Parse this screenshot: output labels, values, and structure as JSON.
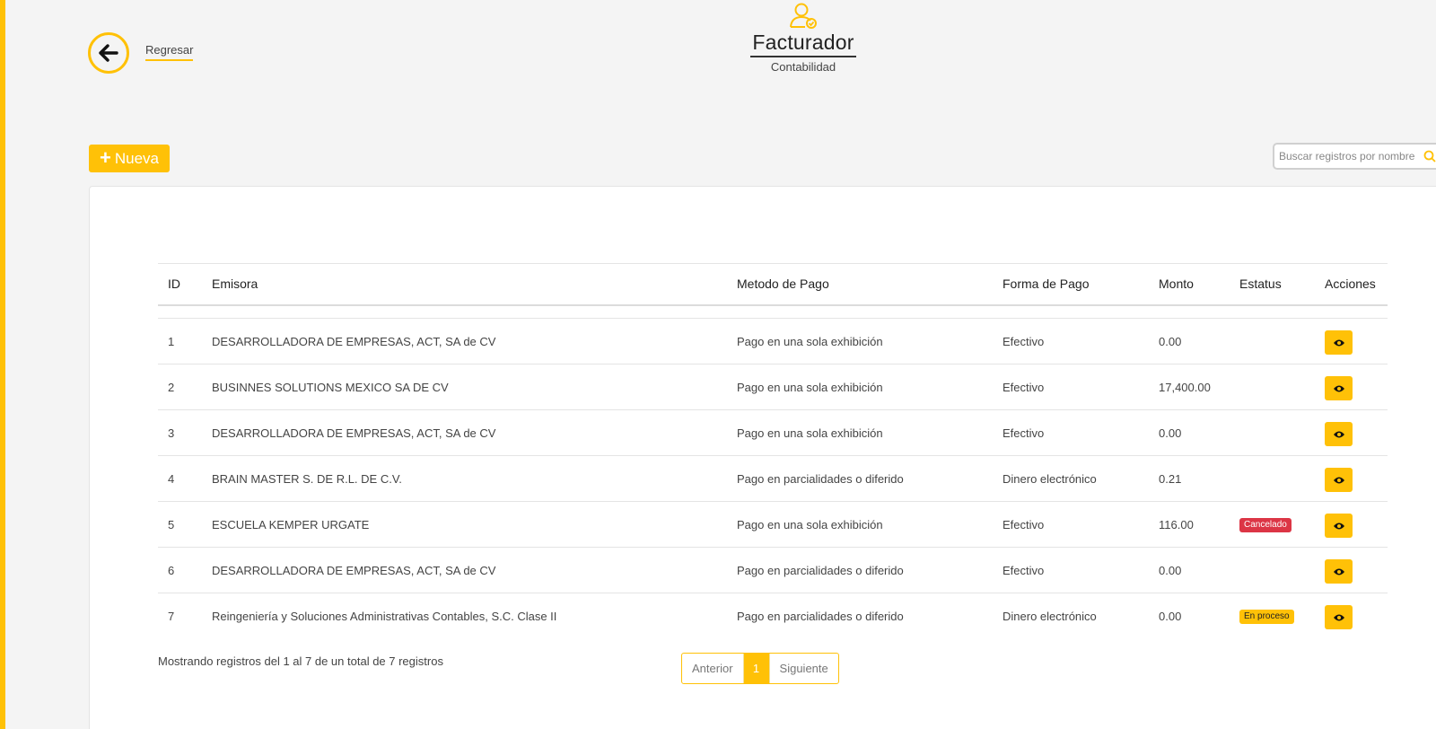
{
  "header": {
    "back_label": "Regresar",
    "title": "Facturador",
    "subtitle": "Contabilidad"
  },
  "toolbar": {
    "new_label": "Nueva",
    "search_placeholder": "Buscar registros por nombre"
  },
  "table": {
    "columns": [
      "ID",
      "Emisora",
      "Metodo de Pago",
      "Forma de Pago",
      "Monto",
      "Estatus",
      "Acciones"
    ],
    "rows": [
      {
        "id": "1",
        "emisora": "DESARROLLADORA DE EMPRESAS, ACT, SA de CV",
        "metodo": "Pago en una sola exhibición",
        "forma": "Efectivo",
        "monto": "0.00",
        "estatus": ""
      },
      {
        "id": "2",
        "emisora": "BUSINNES SOLUTIONS MEXICO SA DE CV",
        "metodo": "Pago en una sola exhibición",
        "forma": "Efectivo",
        "monto": "17,400.00",
        "estatus": ""
      },
      {
        "id": "3",
        "emisora": "DESARROLLADORA DE EMPRESAS, ACT, SA de CV",
        "metodo": "Pago en una sola exhibición",
        "forma": "Efectivo",
        "monto": "0.00",
        "estatus": ""
      },
      {
        "id": "4",
        "emisora": "BRAIN MASTER S. DE R.L. DE C.V.",
        "metodo": "Pago en parcialidades o diferido",
        "forma": "Dinero electrónico",
        "monto": "0.21",
        "estatus": ""
      },
      {
        "id": "5",
        "emisora": "ESCUELA KEMPER URGATE",
        "metodo": "Pago en una sola exhibición",
        "forma": "Efectivo",
        "monto": "116.00",
        "estatus": "Cancelado"
      },
      {
        "id": "6",
        "emisora": "DESARROLLADORA DE EMPRESAS, ACT, SA de CV",
        "metodo": "Pago en parcialidades o diferido",
        "forma": "Efectivo",
        "monto": "0.00",
        "estatus": ""
      },
      {
        "id": "7",
        "emisora": "Reingeniería y Soluciones Administrativas Contables, S.C. Clase II",
        "metodo": "Pago en parcialidades o diferido",
        "forma": "Dinero electrónico",
        "monto": "0.00",
        "estatus": "En proceso"
      }
    ]
  },
  "footer": {
    "info": "Mostrando registros del 1 al 7 de un total de 7 registros",
    "prev_label": "Anterior",
    "current_page": "1",
    "next_label": "Siguiente"
  },
  "colors": {
    "accent": "#ffc107",
    "danger": "#dc3545",
    "background": "#f4f4f4"
  },
  "icons": {
    "back": "arrow-left-icon",
    "header": "user-check-icon",
    "new": "plus-icon",
    "search": "search-icon",
    "view": "eye-icon"
  }
}
